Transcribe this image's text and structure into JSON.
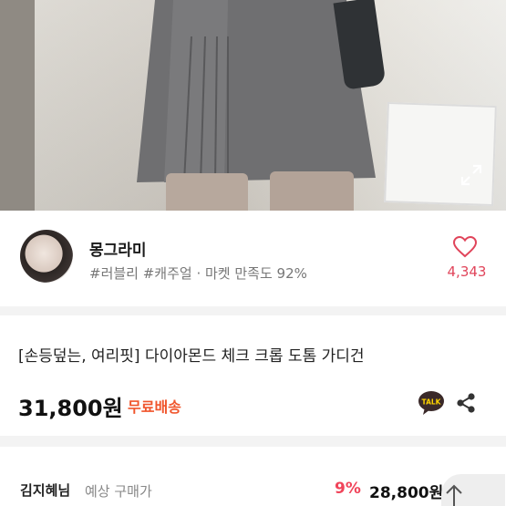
{
  "seller": {
    "name": "몽그라미",
    "tags": "#러블리 #캐주얼 · 마켓 만족도 92%",
    "likes": "4,343"
  },
  "product": {
    "title": "[손등덮는, 여리핏] 다이아몬드 체크 크롭 도톰 가디건",
    "price": "31,800원",
    "shipping": "무료배송"
  },
  "expected": {
    "buyer": "김지혜님",
    "label": "예상 구매가",
    "discount": "9%",
    "price": "28,800원"
  },
  "icons": {
    "expand": "expand-icon",
    "like": "heart-icon",
    "talk": "kakaotalk-icon",
    "share": "share-icon",
    "scroll_top": "up-arrow-icon"
  },
  "colors": {
    "accent_red": "#e0445a",
    "shipping_orange": "#f0552c"
  }
}
